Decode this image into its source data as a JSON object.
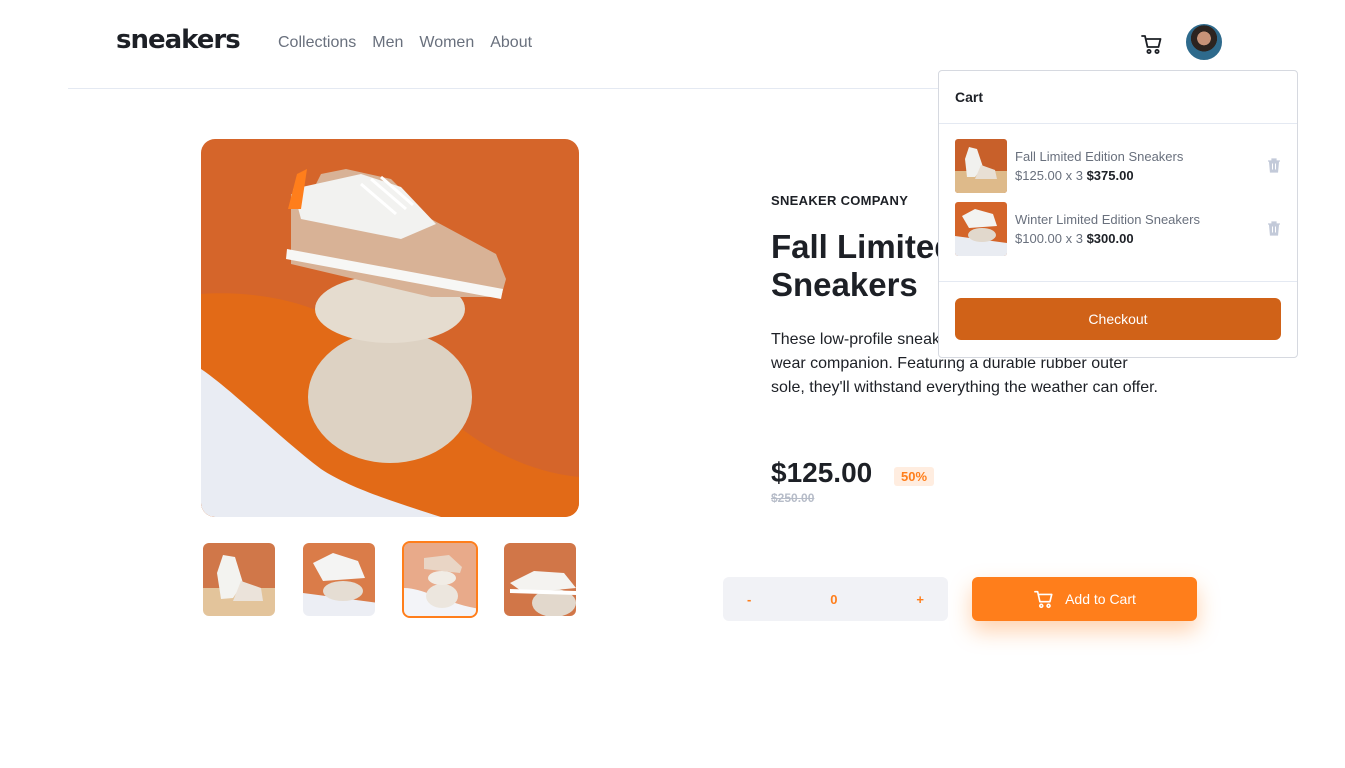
{
  "brand": "sneakers",
  "nav": [
    "Collections",
    "Men",
    "Women",
    "About"
  ],
  "icons": {
    "cart": "cart-icon",
    "avatar": "avatar",
    "delete": "trash-icon",
    "add_cart": "cart-icon"
  },
  "product": {
    "company": "SNEAKER COMPANY",
    "title": "Fall Limited Edition Sneakers",
    "description": "These low-profile sneakers are your perfect casual wear companion. Featuring a durable rubber outer sole, they'll withstand everything the weather can offer.",
    "price": "$125.00",
    "discount": "50%",
    "old_price": "$250.00"
  },
  "quantity": {
    "minus": "-",
    "value": "0",
    "plus": "+"
  },
  "add_to_cart": "Add to Cart",
  "cart": {
    "title": "Cart",
    "items": [
      {
        "name": "Fall Limited Edition Sneakers",
        "unit": "$125.00 x 3",
        "total": "$375.00"
      },
      {
        "name": "Winter Limited Edition Sneakers",
        "unit": "$100.00 x 3",
        "total": "$300.00"
      }
    ],
    "checkout": "Checkout"
  },
  "colors": {
    "accent": "#ff7e1b",
    "checkout": "#d06218",
    "text": "#1d2026",
    "muted": "#69707d"
  }
}
